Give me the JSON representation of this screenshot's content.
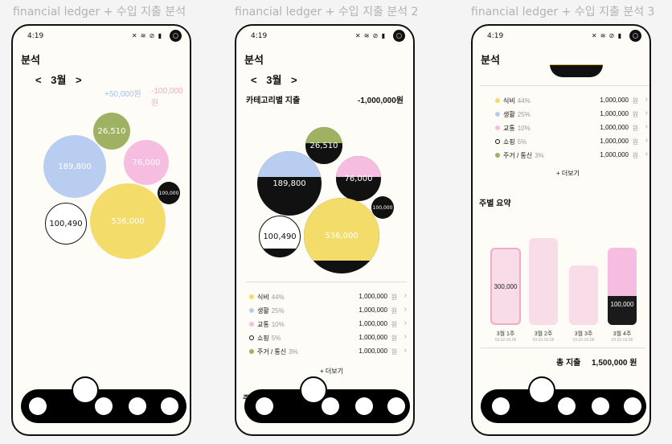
{
  "frames": [
    {
      "label": "financial ledger + 수입 지출 분석"
    },
    {
      "label": "financial ledger + 수입 지출 분석 2"
    },
    {
      "label": "financial ledger + 수입 지출 분석 3"
    }
  ],
  "status": {
    "time": "4:19",
    "icons": "✕ ≋ ⊘ ▮"
  },
  "screen": {
    "title": "분석",
    "month_prev": "<",
    "month_label": "3월",
    "month_next": ">",
    "income": "+50,000원",
    "expense": "-100,000원"
  },
  "bubbles": [
    {
      "label": "189,800",
      "color": "#b9cdf0",
      "fill_fraction": 0.55
    },
    {
      "label": "26,510",
      "color": "#9fb264",
      "fill_fraction": 0.55
    },
    {
      "label": "76,000",
      "color": "#f6bde0",
      "fill_fraction": 0.55
    },
    {
      "label": "100,000",
      "color": "#111111",
      "fill_fraction": 0
    },
    {
      "label": "100,490",
      "color": "#ffffff",
      "fill_fraction": 0.2
    },
    {
      "label": "536,000",
      "color": "#f3dc6a",
      "fill_fraction": 0.85
    }
  ],
  "category_section": {
    "title": "카테고리별 지출",
    "amount": "-1,000,000원"
  },
  "categories": [
    {
      "name": "식비",
      "pct": "44%",
      "amount": "1,000,000",
      "unit": "원",
      "color": "#f3dc6a"
    },
    {
      "name": "생활",
      "pct": "25%",
      "amount": "1,000,000",
      "unit": "원",
      "color": "#b9cdf0"
    },
    {
      "name": "교통",
      "pct": "10%",
      "amount": "1,000,000",
      "unit": "원",
      "color": "#f6bde0"
    },
    {
      "name": "쇼핑",
      "pct": "5%",
      "amount": "1,000,000",
      "unit": "원",
      "color": "#ffffff"
    },
    {
      "name": "주거 / 통신",
      "pct": "3%",
      "amount": "1,000,000",
      "unit": "원",
      "color": "#9fb264"
    }
  ],
  "more_label": "+ 더보기",
  "weekly": {
    "title": "주별 요약",
    "weeks": [
      {
        "label": "3월 1주",
        "range": "03.02-03.08",
        "value_label": "300,000"
      },
      {
        "label": "3월 2주",
        "range": "03.02-03.08",
        "value_label": ""
      },
      {
        "label": "3월 3주",
        "range": "03.02-03.08",
        "value_label": ""
      },
      {
        "label": "3월 4주",
        "range": "03.02-03.08",
        "value_label": "100,000"
      }
    ],
    "total_label": "총 지출",
    "total_value": "1,500,000 원"
  },
  "weekly_title_partial": "주별 요약"
}
